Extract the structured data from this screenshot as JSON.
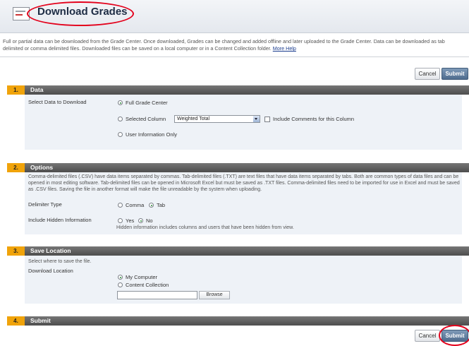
{
  "header": {
    "title": "Download Grades"
  },
  "intro": {
    "text": "Full or partial data can be downloaded from the Grade Center. Once downloaded, Grades can be changed and added offline and later uploaded to the Grade Center. Data can be downloaded as tab delimited or comma delimited files. Downloaded files can be saved on a local computer or in a Content Collection folder.",
    "more_help": "More Help"
  },
  "actions": {
    "cancel": "Cancel",
    "submit": "Submit"
  },
  "sections": {
    "data": {
      "num": "1.",
      "title": "Data",
      "label": "Select Data to Download",
      "opt_full": "Full Grade Center",
      "opt_column": "Selected Column",
      "column_value": "Weighted Total",
      "include_comments": "Include Comments for this Column",
      "opt_user": "User Information Only"
    },
    "options": {
      "num": "2.",
      "title": "Options",
      "desc": "Comma-delimited files (.CSV) have data items separated by commas. Tab-delimited files (.TXT) are text files that have data items separated by tabs. Both are common types of data files and can be opened in most editing software. Tab-delimited files can be opened in Microsoft Excel but must be saved as .TXT files. Comma-delimited files need to be imported for use in Excel and must be saved as .CSV files. Saving the file in another format will make the file unreadable by the system when uploading.",
      "delimiter_label": "Delimiter Type",
      "comma": "Comma",
      "tab": "Tab",
      "hidden_label": "Include Hidden Information",
      "yes": "Yes",
      "no": "No",
      "hidden_desc": "Hidden information includes columns and users that have been hidden from view."
    },
    "save": {
      "num": "3.",
      "title": "Save Location",
      "hint": "Select where to save the file.",
      "label": "Download Location",
      "my_computer": "My Computer",
      "content_collection": "Content Collection",
      "browse": "Browse"
    },
    "submit": {
      "num": "4.",
      "title": "Submit"
    }
  },
  "colors": {
    "accent": "#f0a30a",
    "section_bar": "#5a5a5a",
    "submit_button": "#5f7b9c",
    "highlight_ring": "#e3001b"
  }
}
